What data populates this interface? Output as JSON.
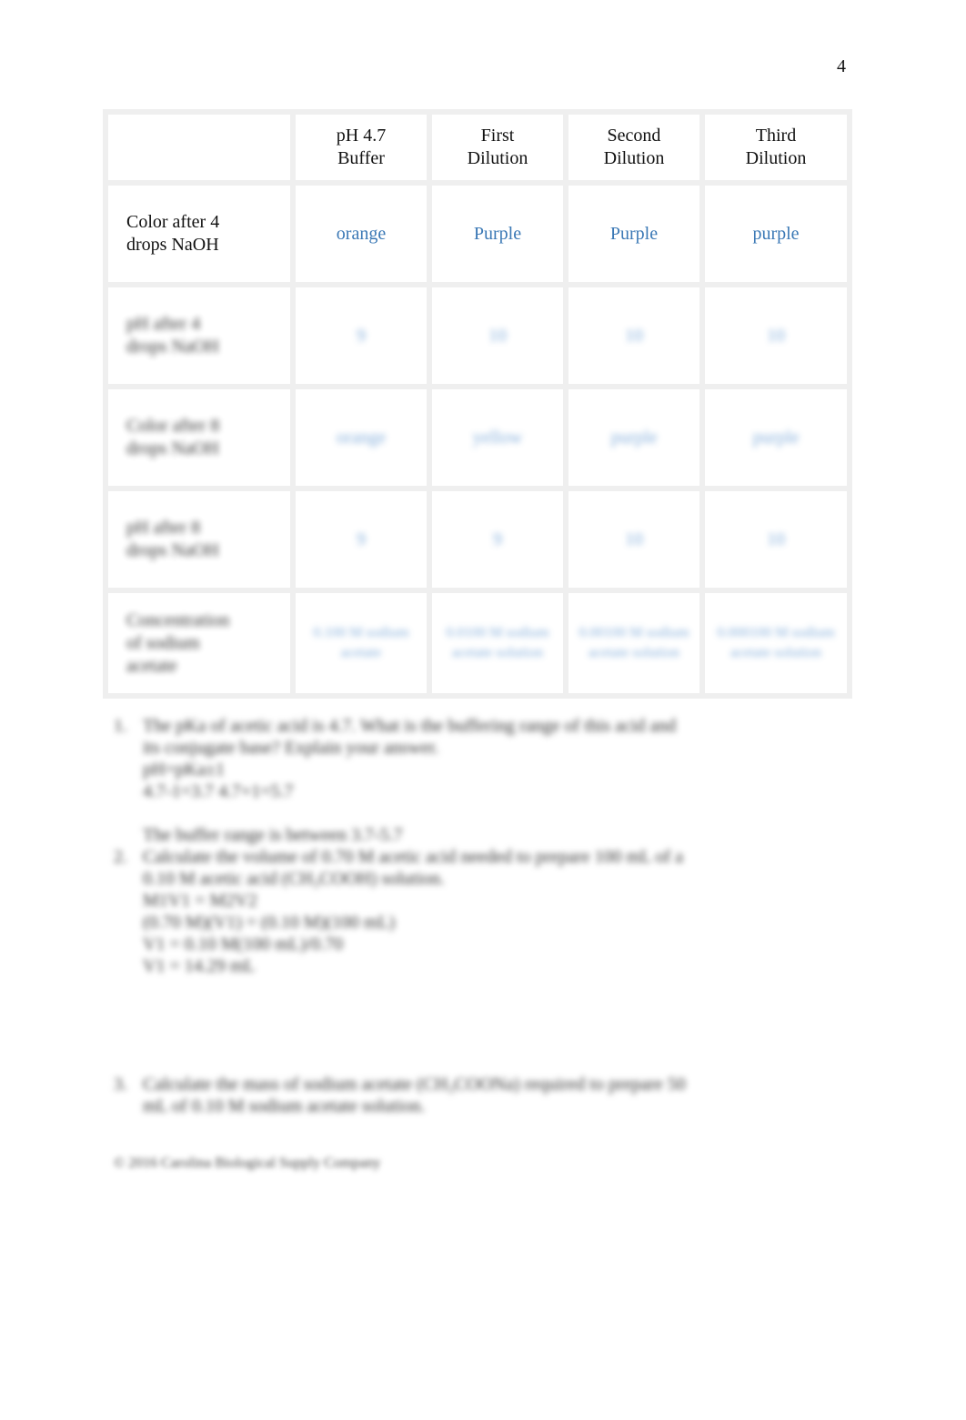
{
  "page_number": "4",
  "table": {
    "headers": [
      "",
      "pH 4.7\nBuffer",
      "First\nDilution",
      "Second\nDilution",
      "Third\nDilution"
    ],
    "header_lines": [
      [
        "",
        ""
      ],
      [
        "pH 4.7",
        "Buffer"
      ],
      [
        "First",
        "Dilution"
      ],
      [
        "Second",
        "Dilution"
      ],
      [
        "Third",
        "Dilution"
      ]
    ],
    "rows": [
      {
        "label_lines": [
          "Color after 4",
          "drops NaOH"
        ],
        "values": [
          "orange",
          "Purple",
          "Purple",
          "purple"
        ],
        "blurred": false
      },
      {
        "label_lines": [
          "pH after 4",
          "drops NaOH"
        ],
        "values": [
          "9",
          "10",
          "10",
          "10"
        ],
        "blurred": true
      },
      {
        "label_lines": [
          "Color after 8",
          "drops NaOH"
        ],
        "values": [
          "orange",
          "yellow",
          "purple",
          "purple"
        ],
        "blurred": true
      },
      {
        "label_lines": [
          "pH after 8",
          "drops NaOH"
        ],
        "values": [
          "9",
          "9",
          "10",
          "10"
        ],
        "blurred": true
      },
      {
        "label_lines": [
          "Concentration",
          "of sodium",
          "acetate"
        ],
        "values": [
          "0.100 M sodium acetate",
          "0.0100 M sodium acetate solution",
          "0.00100 M sodium acetate solution",
          "0.000100 M sodium acetate solution"
        ],
        "blurred": true
      }
    ]
  },
  "questions": [
    {
      "number": "1.",
      "lines": [
        "The pKa of acetic acid is 4.7. What is the buffering range of this acid and",
        "its conjugate base? Explain your answer.",
        "pH=pKa±1",
        "4.7-1=3.7      4.7+1=5.7",
        "",
        "The buffer range is between 3.7-5.7"
      ]
    },
    {
      "number": "2.",
      "lines": [
        "Calculate the volume of 0.70 M acetic acid needed to prepare 100 mL of a",
        "0.10 M acetic acid (CH₃COOH) solution.",
        "M1V1 = M2V2",
        "(0.70 M)(V1) = (0.10 M)(100 mL)",
        "V1 = 0.10 M(100 mL)/0.70",
        "V1 = 14.29 mL"
      ]
    },
    {
      "number": "3.",
      "lines": [
        "Calculate the mass of sodium acetate (CH₃COONa) required to prepare 50",
        "mL of 0.10 M sodium acetate solution."
      ]
    }
  ],
  "footer": "© 2016 Carolina Biological Supply Company"
}
